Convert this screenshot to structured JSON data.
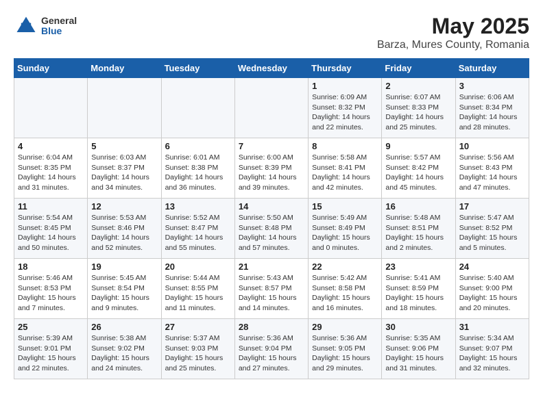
{
  "header": {
    "logo_general": "General",
    "logo_blue": "Blue",
    "title": "May 2025",
    "subtitle": "Barza, Mures County, Romania"
  },
  "days_of_week": [
    "Sunday",
    "Monday",
    "Tuesday",
    "Wednesday",
    "Thursday",
    "Friday",
    "Saturday"
  ],
  "weeks": [
    [
      {
        "day": "",
        "info": ""
      },
      {
        "day": "",
        "info": ""
      },
      {
        "day": "",
        "info": ""
      },
      {
        "day": "",
        "info": ""
      },
      {
        "day": "1",
        "info": "Sunrise: 6:09 AM\nSunset: 8:32 PM\nDaylight: 14 hours\nand 22 minutes."
      },
      {
        "day": "2",
        "info": "Sunrise: 6:07 AM\nSunset: 8:33 PM\nDaylight: 14 hours\nand 25 minutes."
      },
      {
        "day": "3",
        "info": "Sunrise: 6:06 AM\nSunset: 8:34 PM\nDaylight: 14 hours\nand 28 minutes."
      }
    ],
    [
      {
        "day": "4",
        "info": "Sunrise: 6:04 AM\nSunset: 8:35 PM\nDaylight: 14 hours\nand 31 minutes."
      },
      {
        "day": "5",
        "info": "Sunrise: 6:03 AM\nSunset: 8:37 PM\nDaylight: 14 hours\nand 34 minutes."
      },
      {
        "day": "6",
        "info": "Sunrise: 6:01 AM\nSunset: 8:38 PM\nDaylight: 14 hours\nand 36 minutes."
      },
      {
        "day": "7",
        "info": "Sunrise: 6:00 AM\nSunset: 8:39 PM\nDaylight: 14 hours\nand 39 minutes."
      },
      {
        "day": "8",
        "info": "Sunrise: 5:58 AM\nSunset: 8:41 PM\nDaylight: 14 hours\nand 42 minutes."
      },
      {
        "day": "9",
        "info": "Sunrise: 5:57 AM\nSunset: 8:42 PM\nDaylight: 14 hours\nand 45 minutes."
      },
      {
        "day": "10",
        "info": "Sunrise: 5:56 AM\nSunset: 8:43 PM\nDaylight: 14 hours\nand 47 minutes."
      }
    ],
    [
      {
        "day": "11",
        "info": "Sunrise: 5:54 AM\nSunset: 8:45 PM\nDaylight: 14 hours\nand 50 minutes."
      },
      {
        "day": "12",
        "info": "Sunrise: 5:53 AM\nSunset: 8:46 PM\nDaylight: 14 hours\nand 52 minutes."
      },
      {
        "day": "13",
        "info": "Sunrise: 5:52 AM\nSunset: 8:47 PM\nDaylight: 14 hours\nand 55 minutes."
      },
      {
        "day": "14",
        "info": "Sunrise: 5:50 AM\nSunset: 8:48 PM\nDaylight: 14 hours\nand 57 minutes."
      },
      {
        "day": "15",
        "info": "Sunrise: 5:49 AM\nSunset: 8:49 PM\nDaylight: 15 hours\nand 0 minutes."
      },
      {
        "day": "16",
        "info": "Sunrise: 5:48 AM\nSunset: 8:51 PM\nDaylight: 15 hours\nand 2 minutes."
      },
      {
        "day": "17",
        "info": "Sunrise: 5:47 AM\nSunset: 8:52 PM\nDaylight: 15 hours\nand 5 minutes."
      }
    ],
    [
      {
        "day": "18",
        "info": "Sunrise: 5:46 AM\nSunset: 8:53 PM\nDaylight: 15 hours\nand 7 minutes."
      },
      {
        "day": "19",
        "info": "Sunrise: 5:45 AM\nSunset: 8:54 PM\nDaylight: 15 hours\nand 9 minutes."
      },
      {
        "day": "20",
        "info": "Sunrise: 5:44 AM\nSunset: 8:55 PM\nDaylight: 15 hours\nand 11 minutes."
      },
      {
        "day": "21",
        "info": "Sunrise: 5:43 AM\nSunset: 8:57 PM\nDaylight: 15 hours\nand 14 minutes."
      },
      {
        "day": "22",
        "info": "Sunrise: 5:42 AM\nSunset: 8:58 PM\nDaylight: 15 hours\nand 16 minutes."
      },
      {
        "day": "23",
        "info": "Sunrise: 5:41 AM\nSunset: 8:59 PM\nDaylight: 15 hours\nand 18 minutes."
      },
      {
        "day": "24",
        "info": "Sunrise: 5:40 AM\nSunset: 9:00 PM\nDaylight: 15 hours\nand 20 minutes."
      }
    ],
    [
      {
        "day": "25",
        "info": "Sunrise: 5:39 AM\nSunset: 9:01 PM\nDaylight: 15 hours\nand 22 minutes."
      },
      {
        "day": "26",
        "info": "Sunrise: 5:38 AM\nSunset: 9:02 PM\nDaylight: 15 hours\nand 24 minutes."
      },
      {
        "day": "27",
        "info": "Sunrise: 5:37 AM\nSunset: 9:03 PM\nDaylight: 15 hours\nand 25 minutes."
      },
      {
        "day": "28",
        "info": "Sunrise: 5:36 AM\nSunset: 9:04 PM\nDaylight: 15 hours\nand 27 minutes."
      },
      {
        "day": "29",
        "info": "Sunrise: 5:36 AM\nSunset: 9:05 PM\nDaylight: 15 hours\nand 29 minutes."
      },
      {
        "day": "30",
        "info": "Sunrise: 5:35 AM\nSunset: 9:06 PM\nDaylight: 15 hours\nand 31 minutes."
      },
      {
        "day": "31",
        "info": "Sunrise: 5:34 AM\nSunset: 9:07 PM\nDaylight: 15 hours\nand 32 minutes."
      }
    ]
  ]
}
